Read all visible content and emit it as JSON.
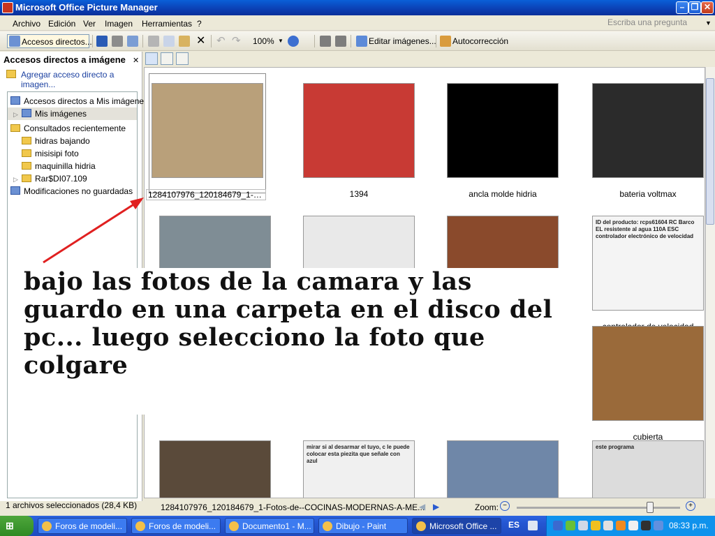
{
  "window": {
    "title": "Microsoft Office Picture Manager"
  },
  "menu": {
    "items": [
      "Archivo",
      "Edición",
      "Ver",
      "Imagen",
      "Herramientas",
      "?"
    ],
    "ask_placeholder": "Escriba una pregunta"
  },
  "toolbar": {
    "shortcuts_button": "Accesos directos...",
    "zoom": "100%",
    "edit_images": "Editar imágenes...",
    "autocorrect": "Autocorrección"
  },
  "left_pane": {
    "title": "Accesos directos a imágene",
    "add_shortcut": "Agregar acceso directo a imagen...",
    "tree": [
      {
        "label": "Accesos directos a Mis imágenes",
        "indent": 0,
        "icon": "gallery-icon"
      },
      {
        "label": "Mis imágenes",
        "indent": 1,
        "icon": "gallery-icon",
        "selected": true,
        "expander": true
      },
      {
        "label": "Consultados recientemente",
        "indent": 0,
        "icon": "folder-icon"
      },
      {
        "label": "hidras bajando",
        "indent": 1,
        "icon": "folder-icon"
      },
      {
        "label": "misisipi foto",
        "indent": 1,
        "icon": "folder-icon"
      },
      {
        "label": "maquinilla hidria",
        "indent": 1,
        "icon": "folder-icon"
      },
      {
        "label": "Rar$DI07.109",
        "indent": 1,
        "icon": "folder-icon",
        "expander": true
      },
      {
        "label": "Modificaciones no guardadas",
        "indent": 0,
        "icon": "gallery-icon"
      }
    ],
    "status": "1 archivos seleccionados (28,4 KB)"
  },
  "thumbnails": [
    {
      "caption": "1284107976_120184679_1-Foto...",
      "selected": true,
      "color": "#b9a07a"
    },
    {
      "caption": "1394",
      "color": "#c83a34"
    },
    {
      "caption": "ancla molde hidria",
      "color": "#000000"
    },
    {
      "caption": "bateria voltmax",
      "color": "#2b2b2b"
    },
    {
      "caption": "",
      "color": "#7f8d95"
    },
    {
      "caption": "",
      "color": "#e9e9e9"
    },
    {
      "caption": "",
      "color": "#8a4a2c"
    },
    {
      "caption": "controlador de velocidad",
      "color": "#f4f4f4",
      "thumb_text": "ID del producto: rcps61604 RC Barco EL resistente al agua 110A ESC controlador electrónico de velocidad"
    },
    {
      "caption": "cubierta",
      "color": "#9a6a3a"
    },
    {
      "caption": "",
      "color": "#5a4a3a"
    },
    {
      "caption": "",
      "color": "#f0f0f0",
      "thumb_text": "mirar si al desarmar el tuyo, c le puede colocar esta piezita que señale con azul"
    },
    {
      "caption": "",
      "color": "#6f87a8"
    },
    {
      "caption": "",
      "color": "#dcdcdc",
      "thumb_text": "este programa"
    }
  ],
  "overlay": {
    "text": "bajo las fotos de la camara y las guardo en una carpeta en el disco del pc... luego selecciono la foto que colgare"
  },
  "status": {
    "filename": "1284107976_120184679_1-Fotos-de--COCINAS-MODERNAS-A-ME...",
    "zoom_label": "Zoom:"
  },
  "taskbar": {
    "tasks": [
      "Foros de modeli...",
      "Foros de modeli...",
      "Documento1 - M...",
      "Dibujo - Paint",
      "Microsoft Office ..."
    ],
    "active_index": 4,
    "lang": "ES",
    "clock": "08:33 p.m."
  },
  "colors": {
    "titlebar": "#0b3fb3",
    "taskbar": "#2456d1",
    "start": "#2f8a24",
    "annotation_arrow": "#e02020"
  }
}
